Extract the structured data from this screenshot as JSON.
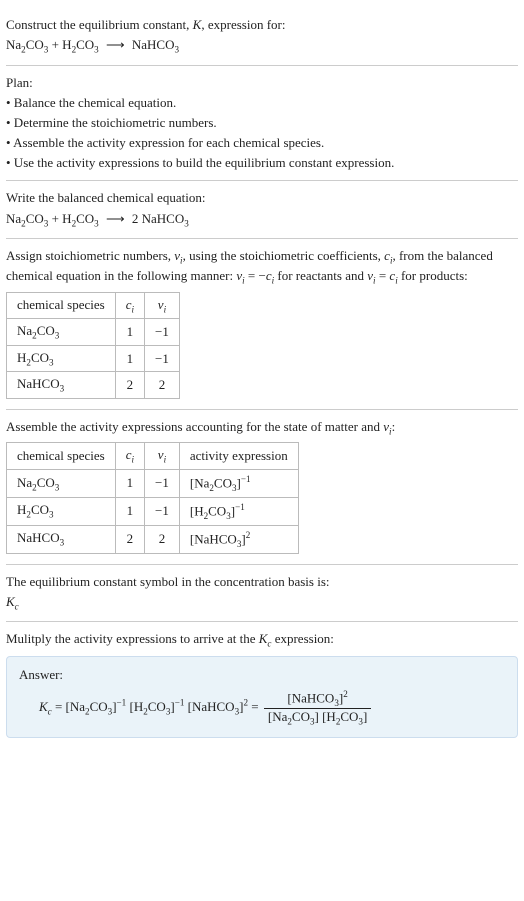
{
  "header": {
    "line1": "Construct the equilibrium constant, K, expression for:",
    "equation": "Na₂CO₃ + H₂CO₃ ⟶ NaHCO₃"
  },
  "plan": {
    "title": "Plan:",
    "b1": "• Balance the chemical equation.",
    "b2": "• Determine the stoichiometric numbers.",
    "b3": "• Assemble the activity expression for each chemical species.",
    "b4": "• Use the activity expressions to build the equilibrium constant expression."
  },
  "balanced": {
    "title": "Write the balanced chemical equation:",
    "equation": "Na₂CO₃ + H₂CO₃ ⟶ 2 NaHCO₃"
  },
  "stoich": {
    "intro": "Assign stoichiometric numbers, νᵢ, using the stoichiometric coefficients, cᵢ, from the balanced chemical equation in the following manner: νᵢ = −cᵢ for reactants and νᵢ = cᵢ for products:",
    "headers": {
      "species": "chemical species",
      "ci": "cᵢ",
      "vi": "νᵢ"
    },
    "rows": [
      {
        "species": "Na₂CO₃",
        "ci": "1",
        "vi": "−1"
      },
      {
        "species": "H₂CO₃",
        "ci": "1",
        "vi": "−1"
      },
      {
        "species": "NaHCO₃",
        "ci": "2",
        "vi": "2"
      }
    ]
  },
  "activity": {
    "intro": "Assemble the activity expressions accounting for the state of matter and νᵢ:",
    "headers": {
      "species": "chemical species",
      "ci": "cᵢ",
      "vi": "νᵢ",
      "expr": "activity expression"
    },
    "rows": [
      {
        "species": "Na₂CO₃",
        "ci": "1",
        "vi": "−1",
        "expr": "[Na₂CO₃]⁻¹"
      },
      {
        "species": "H₂CO₃",
        "ci": "1",
        "vi": "−1",
        "expr": "[H₂CO₃]⁻¹"
      },
      {
        "species": "NaHCO₃",
        "ci": "2",
        "vi": "2",
        "expr": "[NaHCO₃]²"
      }
    ]
  },
  "kc_symbol": {
    "line1": "The equilibrium constant symbol in the concentration basis is:",
    "symbol": "K_c"
  },
  "multiply": {
    "text": "Mulitply the activity expressions to arrive at the K_c expression:"
  },
  "answer": {
    "label": "Answer:",
    "lhs": "K_c = [Na₂CO₃]⁻¹ [H₂CO₃]⁻¹ [NaHCO₃]² = ",
    "num": "[NaHCO₃]²",
    "den": "[Na₂CO₃] [H₂CO₃]"
  },
  "chart_data": {
    "type": "table",
    "stoichiometric_table": {
      "columns": [
        "chemical species",
        "c_i",
        "ν_i"
      ],
      "rows": [
        [
          "Na₂CO₃",
          1,
          -1
        ],
        [
          "H₂CO₃",
          1,
          -1
        ],
        [
          "NaHCO₃",
          2,
          2
        ]
      ]
    },
    "activity_table": {
      "columns": [
        "chemical species",
        "c_i",
        "ν_i",
        "activity expression"
      ],
      "rows": [
        [
          "Na₂CO₃",
          1,
          -1,
          "[Na₂CO₃]^-1"
        ],
        [
          "H₂CO₃",
          1,
          -1,
          "[H₂CO₃]^-1"
        ],
        [
          "NaHCO₃",
          2,
          2,
          "[NaHCO₃]^2"
        ]
      ]
    }
  }
}
